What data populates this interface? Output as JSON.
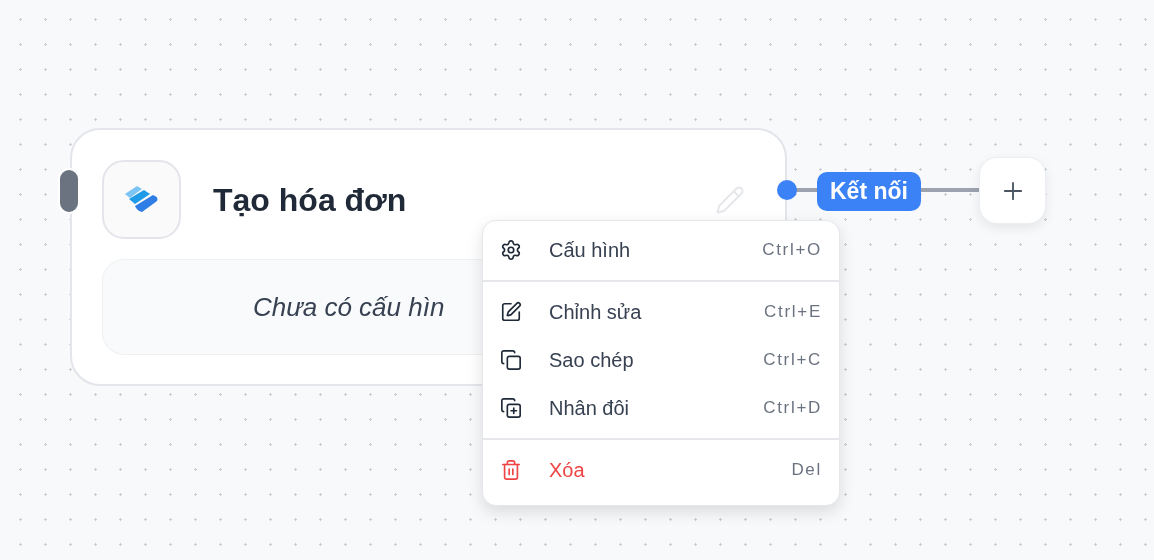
{
  "node": {
    "title": "Tạo hóa đơn",
    "placeholder_text": "Chưa có cấu hìn"
  },
  "connection": {
    "label": "Kết nối"
  },
  "context_menu": {
    "groups": [
      {
        "items": [
          {
            "kind": "settings",
            "label": "Cấu hình",
            "shortcut": "Ctrl+O"
          }
        ]
      },
      {
        "items": [
          {
            "kind": "edit",
            "label": "Chỉnh sửa",
            "shortcut": "Ctrl+E"
          },
          {
            "kind": "copy",
            "label": "Sao chép",
            "shortcut": "Ctrl+C"
          },
          {
            "kind": "duplicate",
            "label": "Nhân đôi",
            "shortcut": "Ctrl+D"
          }
        ]
      },
      {
        "items": [
          {
            "kind": "delete",
            "label": "Xóa",
            "shortcut": "Del"
          }
        ]
      }
    ]
  }
}
